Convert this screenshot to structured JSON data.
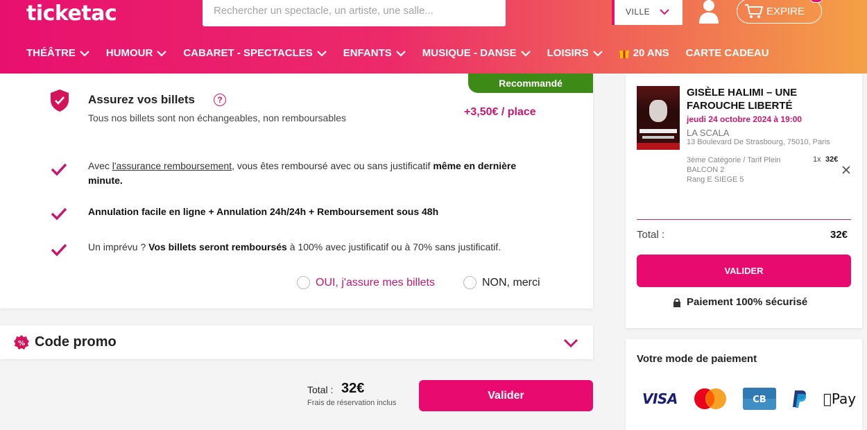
{
  "header": {
    "logo": "ticketac",
    "search_placeholder": "Rechercher un spectacle, un artiste, une salle...",
    "ville_label": "VILLE",
    "expire_label": "EXPIRE",
    "brand_color": "#e8106e"
  },
  "nav": {
    "items": [
      {
        "label": "THÉÂTRE",
        "has_dropdown": true
      },
      {
        "label": "HUMOUR",
        "has_dropdown": true
      },
      {
        "label": "CABARET - SPECTACLES",
        "has_dropdown": true
      },
      {
        "label": "ENFANTS",
        "has_dropdown": true
      },
      {
        "label": "MUSIQUE - DANSE",
        "has_dropdown": true
      },
      {
        "label": "LOISIRS",
        "has_dropdown": true
      },
      {
        "label": "20 ANS",
        "has_dropdown": false,
        "icon": "gift-icon"
      },
      {
        "label": "CARTE CADEAU",
        "has_dropdown": false
      }
    ]
  },
  "insurance": {
    "badge": "Recommandé",
    "title": "Assurez vos billets",
    "help": "?",
    "subtitle": "Tous nos billets sont non échangeables, non remboursables",
    "price": "+3,50€ / place",
    "feature1": {
      "pre": "Avec ",
      "link": "l'assurance remboursement",
      "mid": ", vous êtes remboursé avec ou sans justificatif ",
      "bold": "même en dernière minute."
    },
    "feature2": "Annulation facile en ligne + Annulation 24h/24h + Remboursement sous 48h",
    "feature3": {
      "pre": "Un imprévu ? ",
      "bold": "Vos billets seront remboursés",
      "post": " à 100% avec justificatif ou à 70% sans justificatif."
    },
    "option_yes": "OUI, j'assure mes billets",
    "option_no": "NON, merci"
  },
  "promo": {
    "title": "Code promo"
  },
  "bottom": {
    "total_label": "Total :",
    "total_amount": "32€",
    "fees_note": "Frais de réservation inclus",
    "button": "Valider"
  },
  "summary": {
    "show_title": "GISÈLE HALIMI – UNE FAROUCHE LIBERTÉ",
    "date": "jeudi 24 octobre 2024 à 19:00",
    "venue": "LA SCALA",
    "address": "13 Boulevard De Strasbourg, 75010, Paris",
    "seat_category": "3ème Catégorie / Tarif Plein",
    "seat_zone": "BALCON 2",
    "seat_position": "Rang E SIEGE 5",
    "quantity": "1x",
    "line_price": "32€",
    "total_label": "Total :",
    "total": "32€",
    "button": "VALIDER",
    "secure_note": "Paiement 100% sécurisé"
  },
  "payment": {
    "title": "Votre mode de paiement",
    "methods": [
      "VISA",
      "Mastercard",
      "CB",
      "PayPal",
      "Pay"
    ]
  }
}
